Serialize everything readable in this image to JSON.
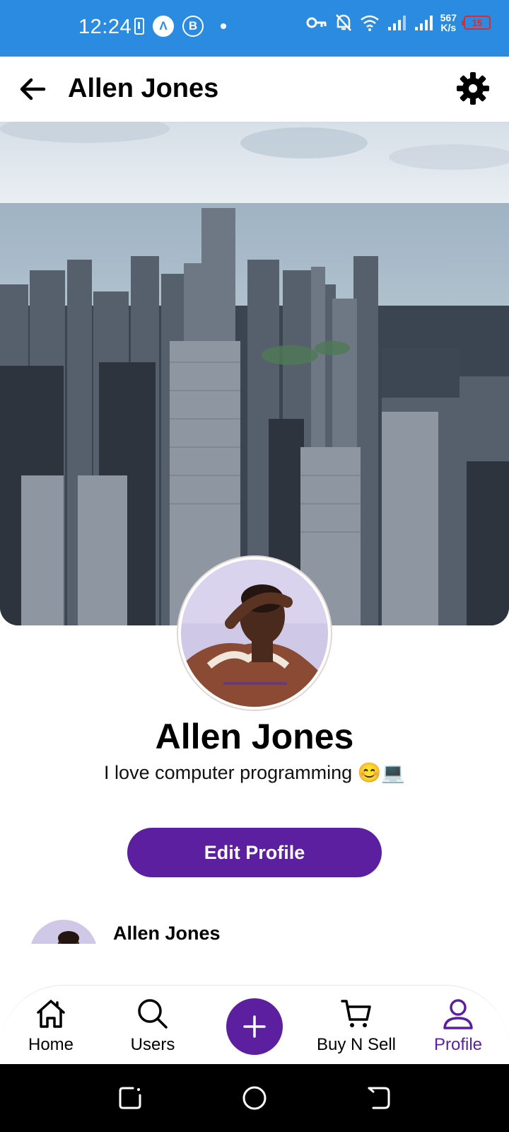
{
  "status_bar": {
    "time": "12:24",
    "net_speed_value": "567",
    "net_speed_unit": "K/s",
    "battery": "15"
  },
  "app_bar": {
    "title": "Allen Jones"
  },
  "profile": {
    "name": "Allen Jones",
    "bio": "I love computer programming 😊💻",
    "edit_button": "Edit Profile"
  },
  "post_preview": {
    "author": "Allen Jones"
  },
  "bottom_nav": {
    "items": [
      {
        "label": "Home",
        "icon": "home-icon"
      },
      {
        "label": "Users",
        "icon": "search-icon"
      },
      {
        "label": "Buy N Sell",
        "icon": "cart-icon"
      },
      {
        "label": "Profile",
        "icon": "person-icon"
      }
    ],
    "active": "Profile",
    "fab_icon": "plus-icon"
  },
  "colors": {
    "status_bar": "#2a8be0",
    "accent": "#5b1fa0",
    "battery_low": "#e02a2a"
  }
}
